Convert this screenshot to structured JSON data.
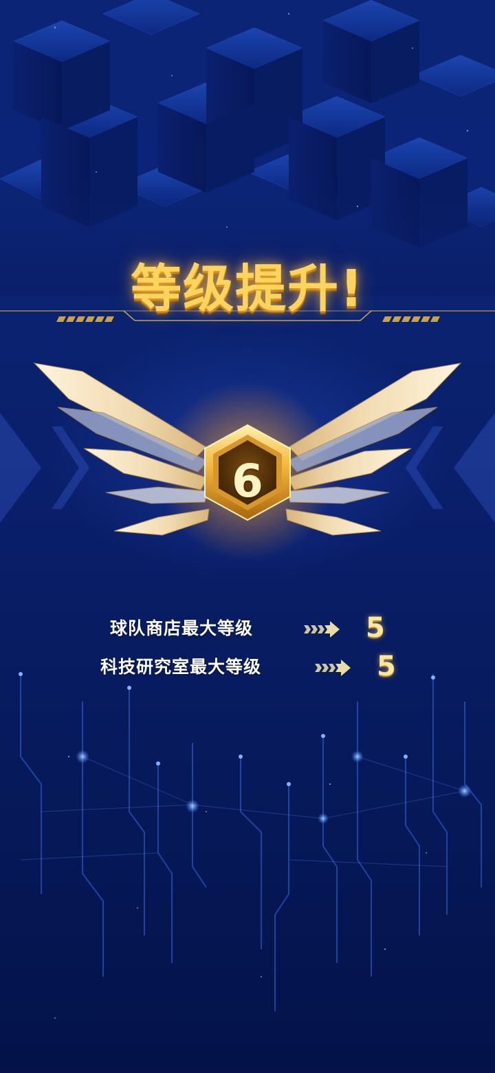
{
  "screen": {
    "title": "等级提升!",
    "level": "6",
    "upgrades": [
      {
        "label": "球队商店最大等级",
        "value": "5"
      },
      {
        "label": "科技研究室最大等级",
        "value": "5"
      }
    ]
  },
  "colors": {
    "background": "#061a5c",
    "title_gold": "#ffd45c",
    "value_gold": "#ffe79a",
    "wing": "#f3e2bd",
    "badge_dark": "#5a3508"
  },
  "icons": {
    "arrow": "triple-chevron-arrow-icon",
    "emblem": "winged-hexagon-emblem"
  }
}
